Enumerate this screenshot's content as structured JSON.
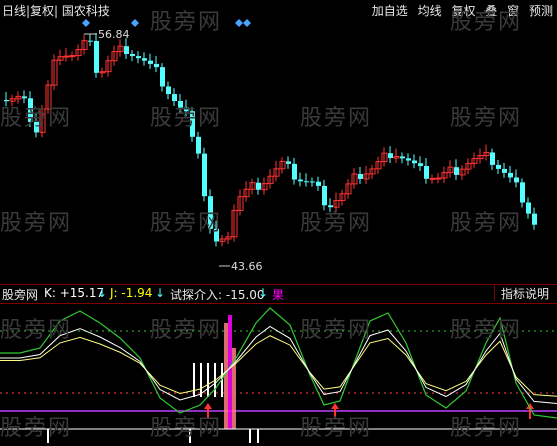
{
  "header": {
    "title": "日线|复权| 国农科技",
    "menu": [
      "加自选",
      "均线",
      "复权",
      "叠",
      "窗",
      "预测"
    ]
  },
  "price_chart": {
    "high_label": "56.84",
    "low_label": "43.66"
  },
  "indicator_bar": {
    "name": "股旁网",
    "k_label": "K: +15.17",
    "k_arrow": "↓",
    "j_label": "J: -1.94",
    "j_arrow": "↓",
    "probe_label": "试探介入: -15.00",
    "probe_arrow": "↓",
    "fruit_label": "果",
    "help_button": "指标说明"
  },
  "watermark": "股旁网",
  "colors": {
    "up": "#ff3232",
    "down": "#54ffff",
    "k_line": "#ffffff",
    "d_line": "#ffff00",
    "j_line": "#32c832",
    "purple": "#ff00ff",
    "pink": "#ff8080"
  }
}
